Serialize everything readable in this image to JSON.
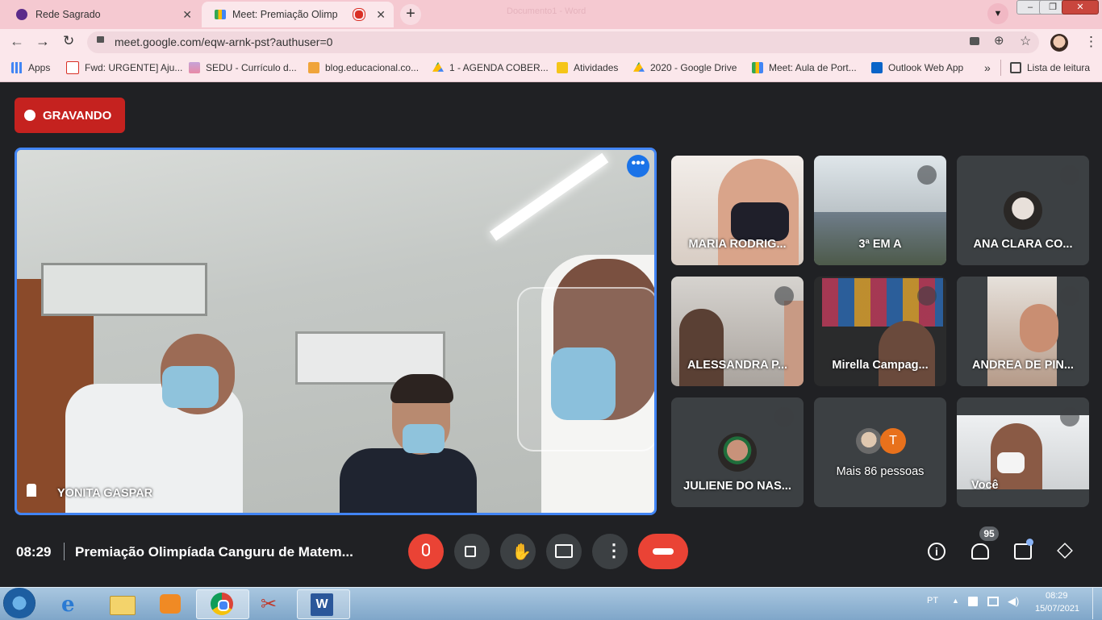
{
  "browser": {
    "tabs": [
      {
        "title": "Rede Sagrado"
      },
      {
        "title": "Meet: Premiação Olimpíada"
      }
    ],
    "ghost_title": "Documento1 - Word",
    "url": "meet.google.com/eqw-arnk-pst?authuser=0",
    "bookmarks": [
      {
        "label": "Apps"
      },
      {
        "label": "Fwd: URGENTE] Aju..."
      },
      {
        "label": "SEDU - Currículo d..."
      },
      {
        "label": "blog.educacional.co..."
      },
      {
        "label": "1 - AGENDA COBER..."
      },
      {
        "label": "Atividades"
      },
      {
        "label": "2020 - Google Drive"
      },
      {
        "label": "Meet: Aula de Port..."
      },
      {
        "label": "Outlook Web App"
      }
    ],
    "overflow": "»",
    "reading_list": "Lista de leitura"
  },
  "meet": {
    "recording_label": "GRAVANDO",
    "main_speaker": "YONITA GASPAR",
    "tiles": [
      {
        "name": "MARIA RODRIG..."
      },
      {
        "name": "3ª EM A"
      },
      {
        "name": "ANA CLARA CO..."
      },
      {
        "name": "ALESSANDRA P..."
      },
      {
        "name": "Mirella Campag..."
      },
      {
        "name": "ANDREA DE PIN..."
      },
      {
        "name": "JULIENE DO NAS..."
      },
      {
        "name": "Mais 86 pessoas",
        "avatar_letter": "T"
      },
      {
        "name": "Você"
      }
    ],
    "time": "08:29",
    "meeting_title": "Premiação Olimpíada Canguru de Matem...",
    "participant_count": "95"
  },
  "taskbar": {
    "lang": "PT",
    "clock_time": "08:29",
    "clock_date": "15/07/2021"
  }
}
